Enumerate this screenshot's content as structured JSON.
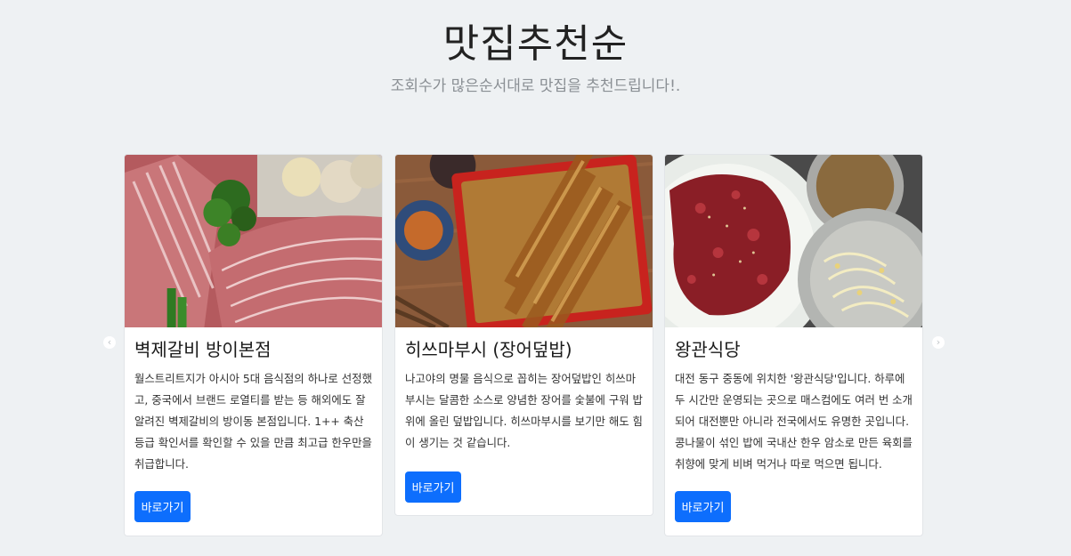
{
  "header": {
    "title": "맛집추천순",
    "subtitle": "조회수가 많은순서대로 맛집을 추천드립니다!."
  },
  "carousel": {
    "prev_icon": "chevron-left-icon",
    "next_icon": "chevron-right-icon",
    "prev_glyph": "‹",
    "next_glyph": "›",
    "cards": [
      {
        "title": "벽제갈비 방이본점",
        "text": "월스트리트지가 아시아 5대 음식점의 하나로 선정했고, 중국에서 브랜드 로열티를 받는 등 해외에도 잘 알려진 벽제갈비의 방이동 본점입니다. 1++ 축산 등급 확인서를 확인할 수 있을 만큼 최고급 한우만을 취급합니다.",
        "button": "바로가기"
      },
      {
        "title": "히쓰마부시 (장어덮밥)",
        "text": "나고야의 명물 음식으로 꼽히는 장어덮밥인 히쓰마부시는 달콤한 소스로 양념한 장어를 숯불에 구워 밥 위에 올린 덮밥입니다. 히쓰마부시를 보기만 해도 힘이 생기는 것 같습니다.",
        "button": "바로가기"
      },
      {
        "title": "왕관식당",
        "text": "대전 동구 중동에 위치한 '왕관식당'입니다. 하루에 두 시간만 운영되는 곳으로 매스컴에도 여러 번 소개되어 대전뿐만 아니라 전국에서도 유명한 곳입니다. 콩나물이 섞인 밥에 국내산 한우 암소로 만든 육회를 취향에 맞게 비벼 먹거나 따로 먹으면 됩니다.",
        "button": "바로가기"
      }
    ]
  },
  "colors": {
    "background": "#eef1f3",
    "button": "#0d6efd"
  }
}
